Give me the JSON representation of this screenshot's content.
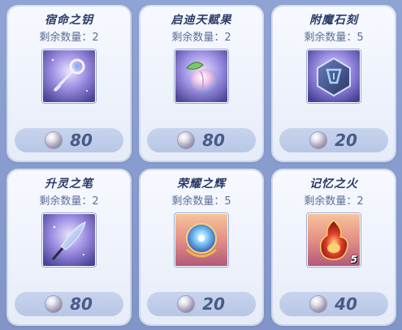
{
  "items": [
    {
      "name": "宿命之钥",
      "stock": "剩余数量：2",
      "price": "80",
      "icon": "key-icon",
      "qty": ""
    },
    {
      "name": "启迪天赋果",
      "stock": "剩余数量：2",
      "price": "80",
      "icon": "fruit-icon",
      "qty": ""
    },
    {
      "name": "附魔石刻",
      "stock": "剩余数量：5",
      "price": "20",
      "icon": "rune-stone-icon",
      "qty": ""
    },
    {
      "name": "升灵之笔",
      "stock": "剩余数量：2",
      "price": "80",
      "icon": "quill-icon",
      "qty": ""
    },
    {
      "name": "荣耀之辉",
      "stock": "剩余数量：5",
      "price": "20",
      "icon": "glory-orb-icon",
      "qty": ""
    },
    {
      "name": "记忆之火",
      "stock": "剩余数量：2",
      "price": "40",
      "icon": "flame-icon",
      "qty": "5"
    }
  ],
  "currency_icon": "pearl-icon"
}
